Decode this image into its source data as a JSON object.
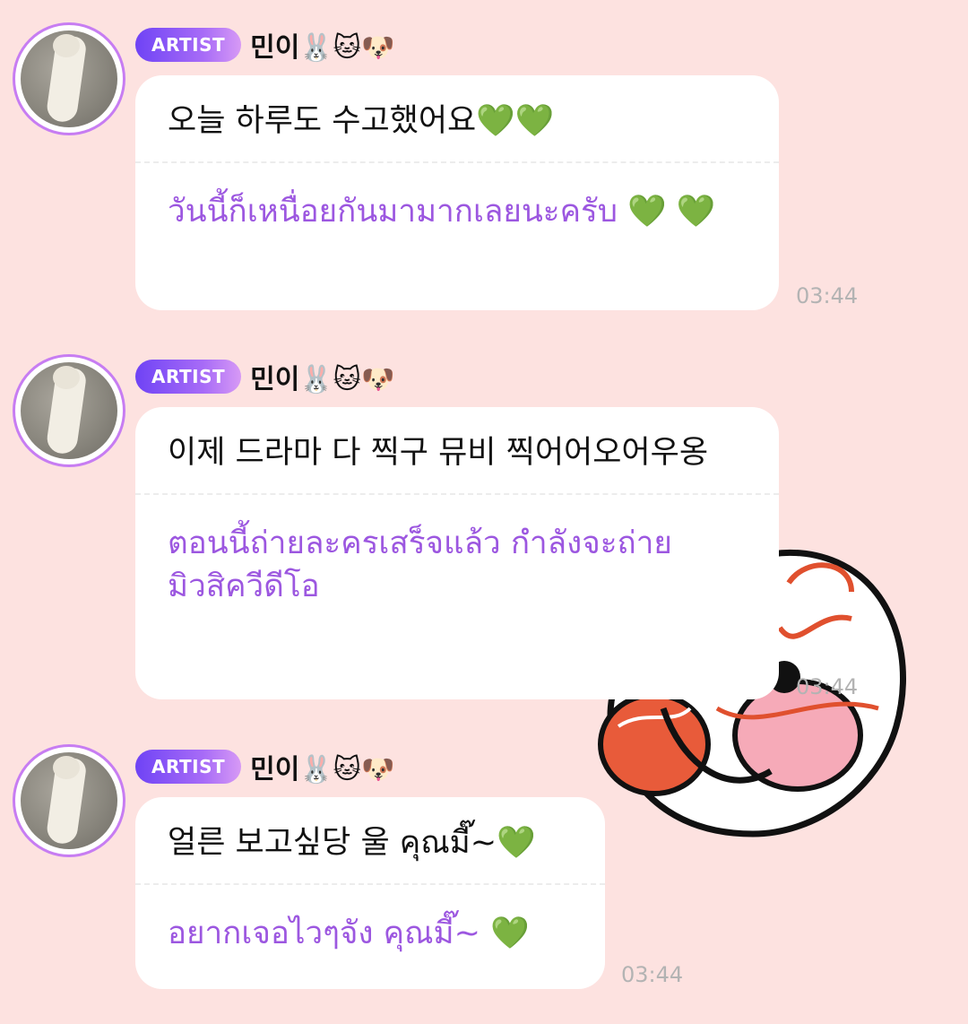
{
  "colors": {
    "background": "#fde2e0",
    "bubble": "#ffffff",
    "translation_text": "#9c57e0",
    "badge_gradient_start": "#6f43f5",
    "badge_gradient_end": "#d79af5",
    "timestamp": "#b3b3b3"
  },
  "messages": [
    {
      "badge": "ARTIST",
      "sender": "민이🐰🐱🐶",
      "original": "오늘 하루도 수고했어요💚💚",
      "translation": "วันนี้ก็เหนื่อยกันมามากเลยนะครับ 💚 💚",
      "time": "03:44"
    },
    {
      "badge": "ARTIST",
      "sender": "민이🐰🐱🐶",
      "original": "이제 드라마 다 찍구 뮤비 찍어어오어우옹",
      "translation": "ตอนนี้ถ่ายละครเสร็จแล้ว กำลังจะถ่ายมิวสิควีดีโอ",
      "time": "03:44"
    },
    {
      "badge": "ARTIST",
      "sender": "민이🐰🐱🐶",
      "original": "얼른 보고싶당 울 คุณมี๊~💚",
      "translation": "อยากเจอไวๆจัง คุณมี๊~ 💚",
      "time": "03:44"
    }
  ],
  "icons": {
    "avatar": "profile-photo-cat",
    "sticker": "pink-character-sticker"
  }
}
